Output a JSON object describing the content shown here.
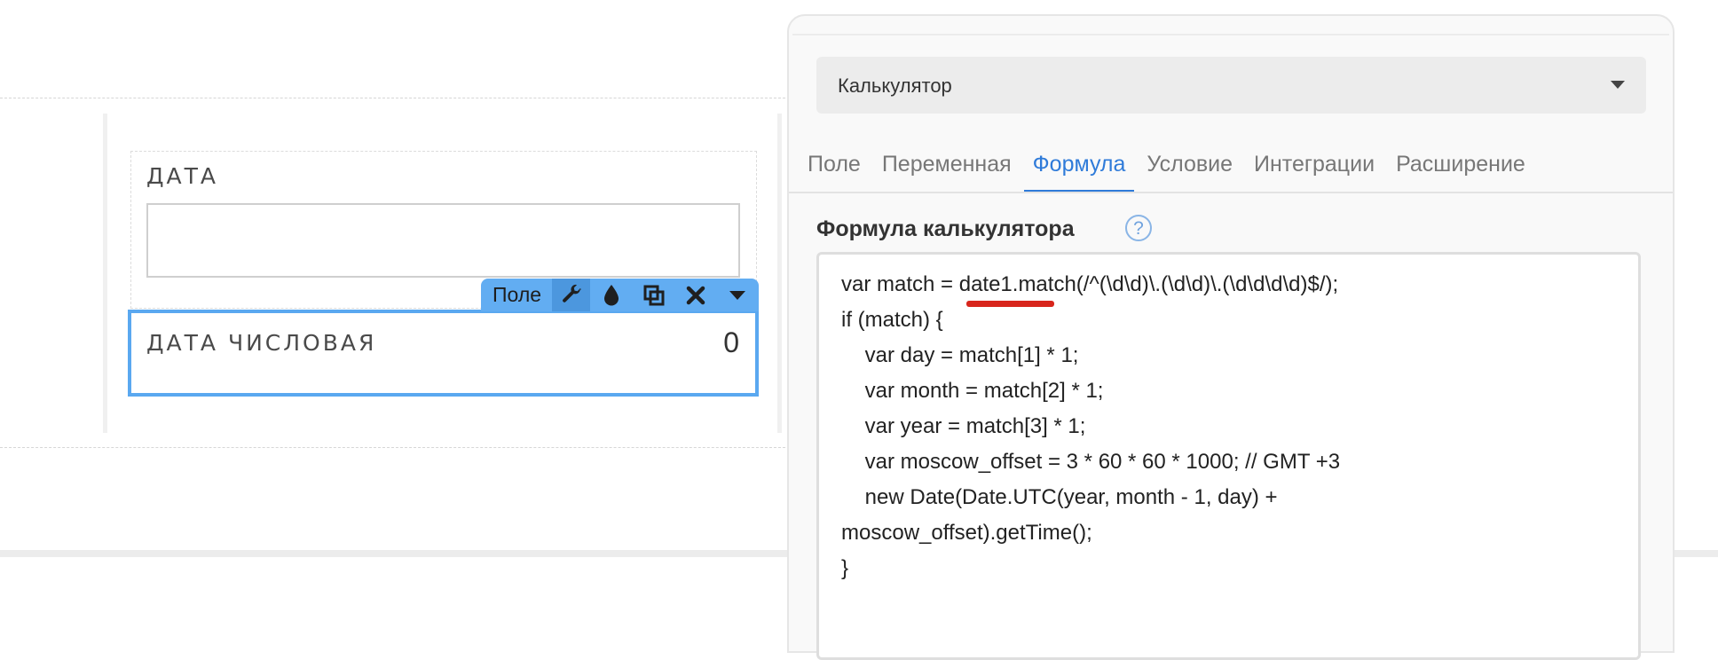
{
  "canvas": {
    "date_field": {
      "label": "ДАТА",
      "value": ""
    },
    "numeric_field": {
      "label": "ДАТА ЧИСЛОВАЯ",
      "value": "0"
    },
    "toolbar": {
      "label": "Поле",
      "buttons": [
        "wrench-icon",
        "drop-icon",
        "copy-icon",
        "close-icon",
        "caret-down-icon"
      ]
    }
  },
  "panel": {
    "select": {
      "value": "Калькулятор"
    },
    "tabs": [
      "Поле",
      "Переменная",
      "Формула",
      "Условие",
      "Интеграции",
      "Расширение"
    ],
    "active_tab": "Формула",
    "section_title": "Формула калькулятора",
    "help": "?",
    "formula": "var match = date1.match(/^(\\d\\d)\\.(\\d\\d)\\.(\\d\\d\\d\\d)$/);\nif (match) {\n    var day = match[1] * 1;\n    var month = match[2] * 1;\n    var year = match[3] * 1;\n    var moscow_offset = 3 * 60 * 60 * 1000; // GMT +3\n    new Date(Date.UTC(year, month - 1, day) +\nmoscow_offset).getTime();\n}"
  },
  "colors": {
    "accent": "#2f7bd9",
    "selection": "#5aa8f0",
    "toolbar": "#62adf2",
    "error": "#d8261c"
  }
}
